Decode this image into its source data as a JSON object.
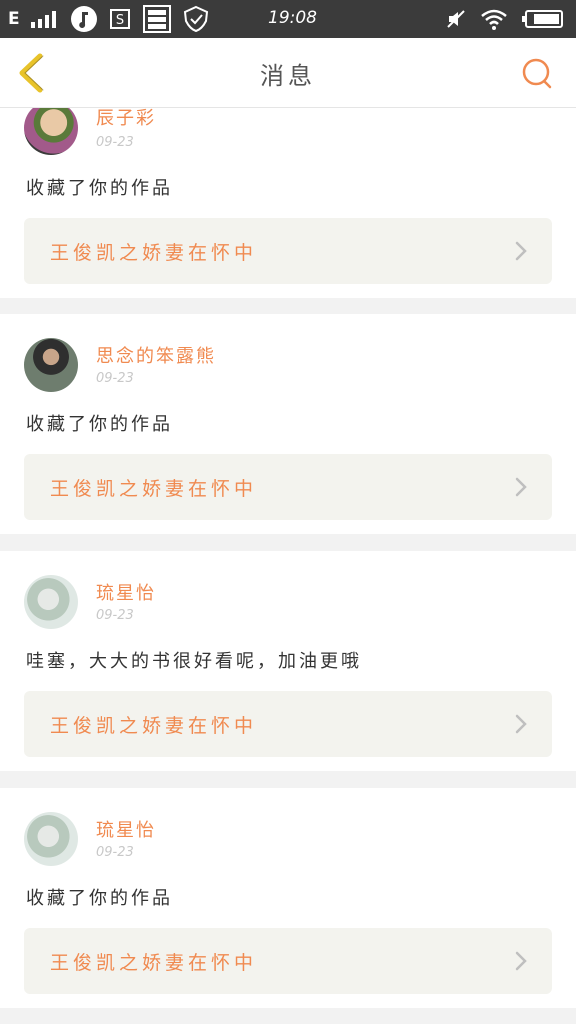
{
  "status_bar": {
    "signal_label": "E",
    "time": "19:08",
    "icons": [
      "signal-icon",
      "music-icon",
      "s-app-icon",
      "storage-icon",
      "shield-icon",
      "mute-icon",
      "wifi-icon",
      "battery-icon"
    ]
  },
  "header": {
    "back_icon": "chevron-left-icon",
    "title": "消息",
    "search_icon": "search-icon"
  },
  "colors": {
    "accent": "#f08a50",
    "back_arrow": "#e8c32a",
    "card_bg": "#ffffff",
    "work_bg": "#f3f3ee",
    "page_bg": "#f2f2f2"
  },
  "messages": [
    {
      "user": "辰子彩",
      "date": "09-23",
      "text": "收藏了你的作品",
      "work_title": "王俊凯之娇妻在怀中"
    },
    {
      "user": "思念的笨露熊",
      "date": "09-23",
      "text": "收藏了你的作品",
      "work_title": "王俊凯之娇妻在怀中"
    },
    {
      "user": "琉星怡",
      "date": "09-23",
      "text": "哇塞，大大的书很好看呢，加油更哦",
      "work_title": "王俊凯之娇妻在怀中"
    },
    {
      "user": "琉星怡",
      "date": "09-23",
      "text": "收藏了你的作品",
      "work_title": "王俊凯之娇妻在怀中"
    }
  ]
}
